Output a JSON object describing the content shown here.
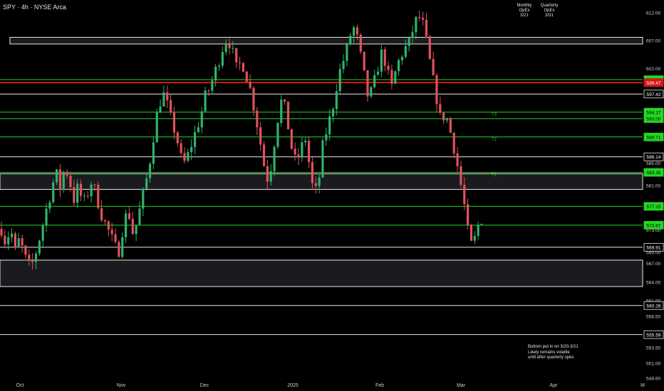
{
  "header": {
    "title": "SPY · 4h · NYSE Arca",
    "monthly_opex": [
      "Monthly",
      "OpEx",
      "3/21"
    ],
    "quarterly_opex": [
      "Quarterly",
      "OpEx",
      "3/31"
    ]
  },
  "note": [
    "Bottom put in on 3/20-3/21",
    "Likely remains volatile",
    "until after quarterly opex"
  ],
  "colors": {
    "background": "#000000",
    "up": "#2fb36a",
    "down": "#e0525c",
    "support_green": "#22d822",
    "level_white": "#e8e8e8",
    "level_red": "#d41818",
    "zone_fill": "#1b1b1f"
  },
  "chart_data": {
    "type": "candlestick",
    "symbol": "SPY",
    "interval": "4h",
    "exchange": "NYSE Arca",
    "x_tick_labels": [
      "Oct",
      "Nov",
      "Dec",
      "2025",
      "Feb",
      "Mar",
      "Apr",
      "M"
    ],
    "y_tick_labels": [
      "612.00",
      "607.00",
      "602.00",
      "597.00",
      "594.00",
      "589.00",
      "585.00",
      "581.00",
      "577.00",
      "573.00",
      "569.00",
      "567.00",
      "564.00",
      "561.00",
      "558.50",
      "556.00",
      "553.50",
      "551.00",
      "548.60"
    ],
    "ylim": [
      548.6,
      612.0
    ],
    "price_scale": [
      [
        612.0,
        0
      ],
      [
        567.0,
        0.686
      ],
      [
        548.6,
        1.0
      ]
    ],
    "levels": [
      {
        "price": 600.0,
        "label": "600.00",
        "kind": "green"
      },
      {
        "price": 599.47,
        "label": "599.47",
        "kind": "red"
      },
      {
        "price": 597.42,
        "label": "597.42",
        "kind": "white"
      },
      {
        "price": 594.17,
        "label": "594.17",
        "kind": "green"
      },
      {
        "price": 593.0,
        "label": "593.00",
        "kind": "green"
      },
      {
        "price": 589.71,
        "label": "589.71",
        "kind": "green"
      },
      {
        "price": 586.14,
        "label": "586.14",
        "kind": "white"
      },
      {
        "price": 583.35,
        "label": "583.35",
        "kind": "green"
      },
      {
        "price": 577.25,
        "label": "577.25",
        "kind": "green"
      },
      {
        "price": 573.87,
        "label": "573.87",
        "kind": "green"
      },
      {
        "price": 569.91,
        "label": "569.91",
        "kind": "white"
      },
      {
        "price": 560.26,
        "label": "560.26",
        "kind": "white"
      },
      {
        "price": 555.59,
        "label": "555.59",
        "kind": "white"
      }
    ],
    "zones": [
      {
        "from": 606.4,
        "to": 607.6
      },
      {
        "from": 583.1,
        "to": 580.3
      },
      {
        "from": 567.6,
        "to": 563.3
      }
    ],
    "target_labels": [
      "T3",
      "T2",
      "T1"
    ],
    "price_path": [
      573.2,
      570.5,
      573.6,
      569.0,
      571.5,
      568.5,
      566.5,
      567.2,
      570.2,
      573.5,
      577.0,
      580.0,
      583.5,
      580.5,
      584.5,
      582.0,
      578.5,
      581.0,
      577.5,
      579.5,
      582.0,
      579.0,
      576.0,
      574.0,
      572.2,
      570.0,
      569.3,
      574.5,
      576.5,
      572.5,
      574.5,
      578.5,
      582.0,
      586.5,
      592.5,
      596.0,
      597.5,
      594.0,
      591.5,
      588.5,
      584.5,
      586.0,
      588.5,
      591.0,
      593.5,
      597.0,
      598.5,
      601.0,
      603.5,
      606.2,
      607.5,
      605.0,
      601.5,
      603.5,
      601.0,
      598.0,
      594.0,
      589.5,
      584.5,
      581.5,
      587.5,
      593.0,
      597.0,
      593.0,
      588.0,
      585.0,
      587.0,
      590.0,
      584.5,
      579.0,
      581.5,
      588.5,
      591.5,
      594.5,
      599.0,
      602.5,
      604.5,
      608.0,
      609.5,
      605.5,
      601.0,
      596.5,
      598.5,
      602.0,
      605.0,
      602.5,
      598.0,
      601.5,
      604.0,
      605.5,
      606.5,
      609.5,
      611.5,
      610.0,
      606.0,
      601.0,
      597.0,
      592.5,
      594.0,
      591.0,
      587.5,
      583.0,
      578.5,
      572.5,
      569.5,
      573.5,
      575.0
    ]
  }
}
